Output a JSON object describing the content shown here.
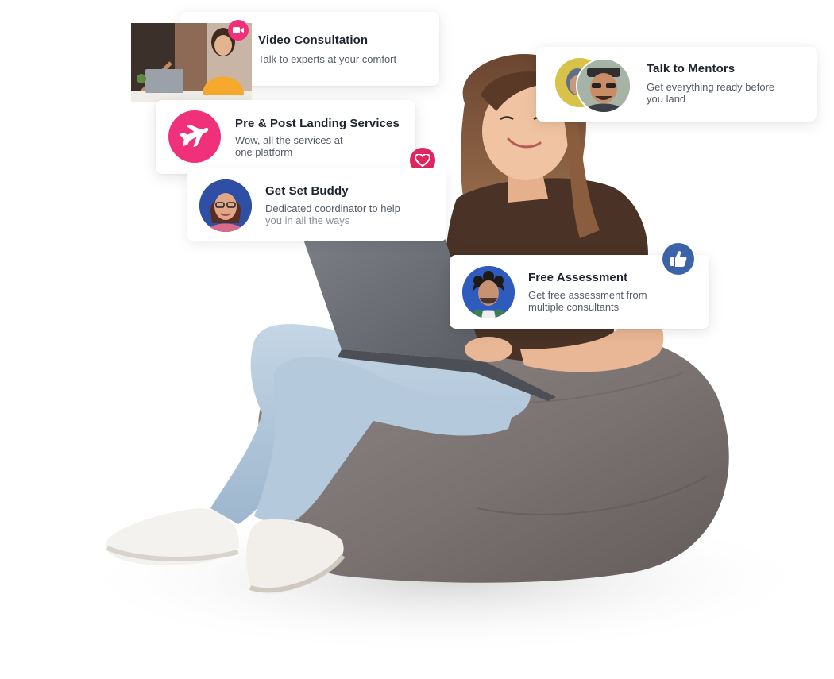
{
  "cards": {
    "video": {
      "title": "Video Consultation",
      "desc": "Talk to experts at your comfort"
    },
    "mentors": {
      "title": "Talk to Mentors",
      "desc_line1": "Get everything ready before",
      "desc_line2": "you land"
    },
    "landing": {
      "title": "Pre & Post Landing Services",
      "desc_line1": "Wow, all the services at",
      "desc_line2": "one platform"
    },
    "buddy": {
      "title": "Get Set Buddy",
      "desc_line1": "Dedicated coordinator to help",
      "desc_line2": "you in all the ways"
    },
    "assessment": {
      "title": "Free Assessment",
      "desc_line1": "Get free assessment from",
      "desc_line2": "multiple consultants"
    }
  },
  "colors": {
    "brand_pink": "#f0307a",
    "like_blue": "#3b64a8",
    "heart_red": "#e0245e"
  },
  "icons": [
    "video-camera-icon",
    "airplane-icon",
    "heart-icon",
    "thumbs-up-icon"
  ]
}
